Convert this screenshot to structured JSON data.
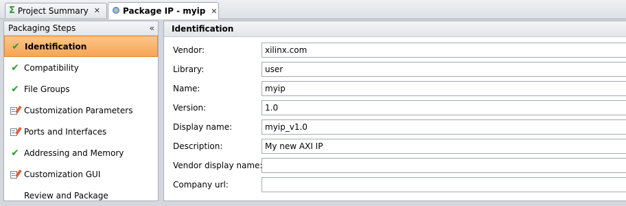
{
  "tabs": [
    {
      "label": "Project Summary",
      "icon": "sigma-icon",
      "active": false
    },
    {
      "label": "Package IP - myip",
      "icon": "package-icon",
      "active": true
    }
  ],
  "left_panel": {
    "title": "Packaging Steps",
    "collapse_glyph": "«",
    "steps": [
      {
        "label": "Identification",
        "icon": "check-icon",
        "selected": true
      },
      {
        "label": "Compatibility",
        "icon": "check-icon"
      },
      {
        "label": "File Groups",
        "icon": "check-icon"
      },
      {
        "label": "Customization Parameters",
        "icon": "edit-icon"
      },
      {
        "label": "Ports and Interfaces",
        "icon": "edit-icon"
      },
      {
        "label": "Addressing and Memory",
        "icon": "check-icon"
      },
      {
        "label": "Customization GUI",
        "icon": "edit-icon"
      },
      {
        "label": "Review and Package",
        "icon": ""
      }
    ]
  },
  "main": {
    "section_title": "Identification",
    "fields": [
      {
        "label": "Vendor:",
        "value": "xilinx.com"
      },
      {
        "label": "Library:",
        "value": "user"
      },
      {
        "label": "Name:",
        "value": "myip"
      },
      {
        "label": "Version:",
        "value": "1.0"
      },
      {
        "label": "Display name:",
        "value": "myip_v1.0"
      },
      {
        "label": "Description:",
        "value": "My new AXI IP"
      },
      {
        "label": "Vendor display name:",
        "value": ""
      },
      {
        "label": "Company url:",
        "value": ""
      }
    ]
  },
  "colors": {
    "selected_step": "#f5a554",
    "check": "#2d9b2d"
  }
}
